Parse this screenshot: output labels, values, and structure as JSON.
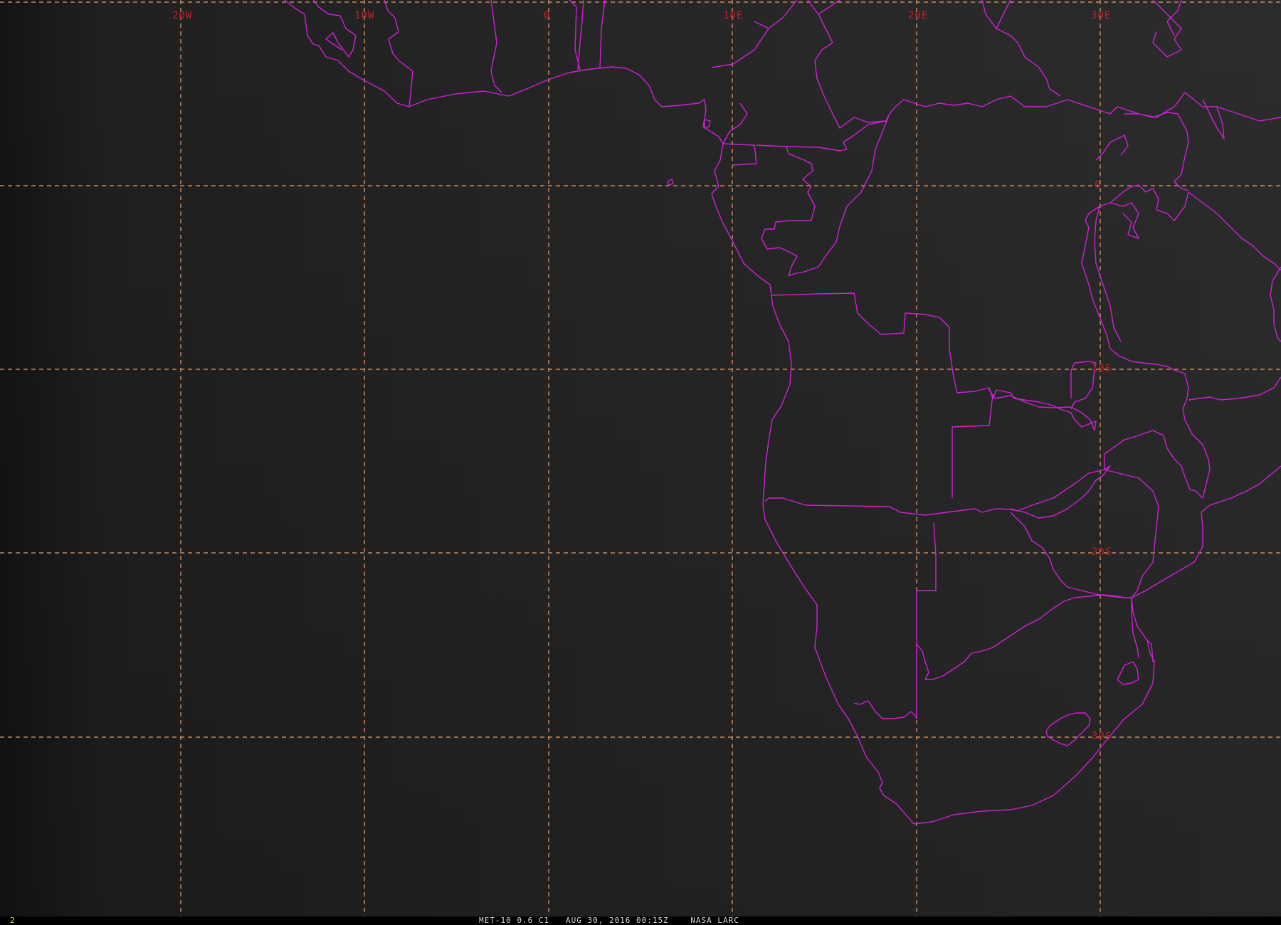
{
  "map": {
    "lon_labels": [
      "20W",
      "10W",
      "0",
      "10E",
      "20E",
      "30E"
    ],
    "lat_labels": [
      "0",
      "10S",
      "20S",
      "30S"
    ],
    "colors": {
      "background": "#242424",
      "grid": "#e0a070",
      "grid_label": "#c0202a",
      "borders": "#d020d8",
      "frame_number": "#e8e020"
    }
  },
  "status": {
    "frame": "2",
    "caption": "MET-10 0.6 C1   AUG 30, 2016 00:15Z    NASA LARC"
  }
}
